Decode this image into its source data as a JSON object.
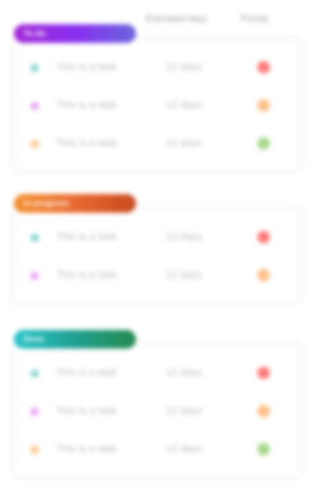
{
  "headers": {
    "estimate": "Estimated days",
    "priority": "Priority"
  },
  "groups": [
    {
      "label": "To do",
      "gradient": [
        "#a22ad6",
        "#8a2ef0",
        "#6a66dd"
      ],
      "rows": [
        {
          "task": "This is a task",
          "days": "12 days",
          "dot": "#8fd8d2",
          "priority_color": "#ff7a7a"
        },
        {
          "task": "This is a task",
          "days": "12 days",
          "dot": "#eaa8f5",
          "priority_color": "#ffc088"
        },
        {
          "task": "This is a task",
          "days": "12 days",
          "dot": "#ffc890",
          "priority_color": "#a8d88a"
        }
      ]
    },
    {
      "label": "In progress",
      "gradient": [
        "#f49030",
        "#e86a30",
        "#c84a20"
      ],
      "rows": [
        {
          "task": "This is a task",
          "days": "12 days",
          "dot": "#8fd8d2",
          "priority_color": "#ff7a7a"
        },
        {
          "task": "This is a task",
          "days": "12 days",
          "dot": "#eaa8f5",
          "priority_color": "#ffc088"
        }
      ]
    },
    {
      "label": "Done",
      "gradient": [
        "#28c4cc",
        "#20a090",
        "#228a50"
      ],
      "rows": [
        {
          "task": "This is a task",
          "days": "12 days",
          "dot": "#8fd8d2",
          "priority_color": "#ff7a7a"
        },
        {
          "task": "This is a task",
          "days": "12 days",
          "dot": "#eaa8f5",
          "priority_color": "#ffc088"
        },
        {
          "task": "This is a task",
          "days": "12 days",
          "dot": "#ffc890",
          "priority_color": "#a8d88a"
        }
      ]
    }
  ]
}
